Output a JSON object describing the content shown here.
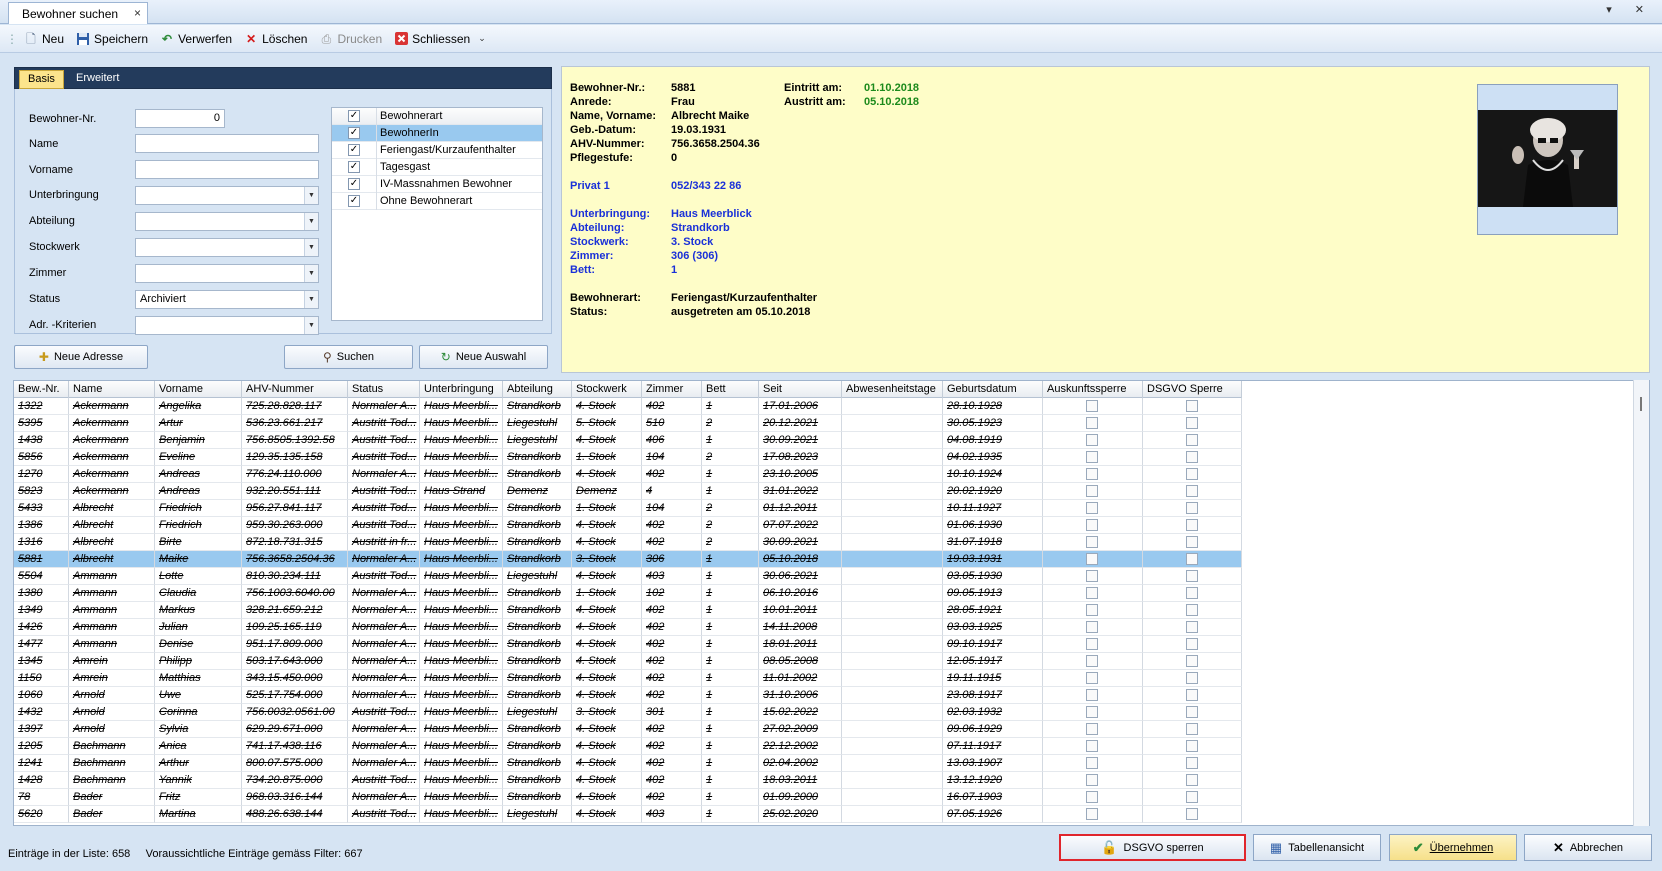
{
  "window": {
    "tab_title": "Bewohner suchen",
    "tab_close": "×",
    "controls": "▾ ✕"
  },
  "toolbar": {
    "grip": "⋮",
    "buttons": [
      {
        "label": "Neu",
        "icon": "new-doc-icon",
        "glyph": "🗋"
      },
      {
        "label": "Speichern",
        "icon": "save-icon",
        "glyph": "💾"
      },
      {
        "label": "Verwerfen",
        "icon": "discard-icon",
        "glyph": "↶"
      },
      {
        "label": "Löschen",
        "icon": "delete-icon",
        "glyph": "✕"
      },
      {
        "label": "Drucken",
        "icon": "print-icon",
        "glyph": "⎙"
      },
      {
        "label": "Schliessen",
        "icon": "close-icon",
        "glyph": "✖"
      }
    ],
    "more": "⌄"
  },
  "search": {
    "tabs": [
      "Basis",
      "Erweitert"
    ],
    "labels": {
      "bewohner_nr": "Bewohner-Nr.",
      "name": "Name",
      "vorname": "Vorname",
      "unterbringung": "Unterbringung",
      "abteilung": "Abteilung",
      "stockwerk": "Stockwerk",
      "zimmer": "Zimmer",
      "status": "Status",
      "adr_kriterien": "Adr. -Kriterien"
    },
    "values": {
      "bewohner_nr": "0",
      "name": "",
      "vorname": "",
      "unterbringung": "",
      "abteilung": "",
      "stockwerk": "",
      "zimmer": "",
      "status": "Archiviert",
      "adr_kriterien": ""
    },
    "types": [
      {
        "label": "Bewohnerart",
        "checked": true
      },
      {
        "label": "BewohnerIn",
        "checked": true
      },
      {
        "label": "Feriengast/Kurzaufenthalter",
        "checked": true
      },
      {
        "label": "Tagesgast",
        "checked": true
      },
      {
        "label": "IV-Massnahmen Bewohner",
        "checked": true
      },
      {
        "label": "Ohne Bewohnerart",
        "checked": true
      }
    ],
    "buttons": {
      "neue_adresse": "Neue Adresse",
      "suchen": "Suchen",
      "neue_auswahl": "Neue Auswahl"
    }
  },
  "detail": {
    "labels": {
      "bewohner_nr": "Bewohner-Nr.:",
      "anrede": "Anrede:",
      "name_vorname": "Name, Vorname:",
      "geb_datum": "Geb.-Datum:",
      "ahv": "AHV-Nummer:",
      "pflegestufe": "Pflegestufe:",
      "privat": "Privat 1",
      "unterbringung": "Unterbringung:",
      "abteilung": "Abteilung:",
      "stockwerk": "Stockwerk:",
      "zimmer": "Zimmer:",
      "bett": "Bett:",
      "bewohnerart": "Bewohnerart:",
      "status": "Status:",
      "eintritt": "Eintritt am:",
      "austritt": "Austritt am:"
    },
    "values": {
      "bewohner_nr": "5881",
      "anrede": "Frau",
      "name_vorname": "Albrecht Maike",
      "geb_datum": "19.03.1931",
      "ahv": "756.3658.2504.36",
      "pflegestufe": "0",
      "privat": "052/343 22 86",
      "unterbringung": "Haus Meerblick",
      "abteilung": "Strandkorb",
      "stockwerk": "3. Stock",
      "zimmer": "306 (306)",
      "bett": "1",
      "bewohnerart": "Feriengast/Kurzaufenthalter",
      "status": "ausgetreten am 05.10.2018",
      "eintritt": "01.10.2018",
      "austritt": "05.10.2018"
    }
  },
  "grid": {
    "columns": [
      "Bew.-Nr.",
      "Name",
      "Vorname",
      "AHV-Nummer",
      "Status",
      "Unterbringung",
      "Abteilung",
      "Stockwerk",
      "Zimmer",
      "Bett",
      "Seit",
      "Abwesenheitstage",
      "Geburtsdatum",
      "Auskunftssperre",
      "DSGVO Sperre"
    ],
    "selected_index": 9,
    "rows": [
      [
        "1322",
        "Ackermann",
        "Angelika",
        "725.28.828.117",
        "Normaler A...",
        "Haus Meerbli...",
        "Strandkorb",
        "4. Stock",
        "402",
        "1",
        "17.01.2006",
        "",
        "28.10.1928"
      ],
      [
        "5395",
        "Ackermann",
        "Artur",
        "536.23.661.217",
        "Austritt Tod...",
        "Haus Meerbli...",
        "Liegestuhl",
        "5. Stock",
        "510",
        "2",
        "20.12.2021",
        "",
        "30.05.1923"
      ],
      [
        "1438",
        "Ackermann",
        "Benjamin",
        "756.8505.1392.58",
        "Austritt Tod...",
        "Haus Meerbli...",
        "Liegestuhl",
        "4. Stock",
        "406",
        "1",
        "30.09.2021",
        "",
        "04.08.1919"
      ],
      [
        "5856",
        "Ackermann",
        "Eveline",
        "129.35.135.158",
        "Austritt Tod...",
        "Haus Meerbli...",
        "Strandkorb",
        "1. Stock",
        "104",
        "2",
        "17.08.2023",
        "",
        "04.02.1935"
      ],
      [
        "1270",
        "Ackermann",
        "Andreas",
        "776.24.110.000",
        "Normaler A...",
        "Haus Meerbli...",
        "Strandkorb",
        "4. Stock",
        "402",
        "1",
        "23.10.2005",
        "",
        "10.10.1924"
      ],
      [
        "5823",
        "Ackermann",
        "Andreas",
        "932.20.551.111",
        "Austritt Tod...",
        "Haus Strand",
        "Demenz",
        "Demenz",
        "4",
        "1",
        "31.01.2022",
        "",
        "20.02.1920"
      ],
      [
        "5433",
        "Albrecht",
        "Friedrich",
        "956.27.841.117",
        "Austritt Tod...",
        "Haus Meerbli...",
        "Strandkorb",
        "1. Stock",
        "104",
        "2",
        "01.12.2011",
        "",
        "10.11.1927"
      ],
      [
        "1386",
        "Albrecht",
        "Friedrich",
        "959.30.263.000",
        "Austritt Tod...",
        "Haus Meerbli...",
        "Strandkorb",
        "4. Stock",
        "402",
        "2",
        "07.07.2022",
        "",
        "01.06.1930"
      ],
      [
        "1316",
        "Albrecht",
        "Birte",
        "872.18.731.315",
        "Austritt in fr...",
        "Haus Meerbli...",
        "Strandkorb",
        "4. Stock",
        "402",
        "2",
        "30.09.2021",
        "",
        "31.07.1918"
      ],
      [
        "5881",
        "Albrecht",
        "Maike",
        "756.3658.2504.36",
        "Normaler A...",
        "Haus Meerbli...",
        "Strandkorb",
        "3. Stock",
        "306",
        "1",
        "05.10.2018",
        "",
        "19.03.1931"
      ],
      [
        "5504",
        "Ammann",
        "Lotte",
        "810.30.234.111",
        "Austritt Tod...",
        "Haus Meerbli...",
        "Liegestuhl",
        "4. Stock",
        "403",
        "1",
        "30.06.2021",
        "",
        "03.05.1930"
      ],
      [
        "1380",
        "Ammann",
        "Claudia",
        "756.1003.6040.00",
        "Normaler A...",
        "Haus Meerbli...",
        "Strandkorb",
        "1. Stock",
        "102",
        "1",
        "06.10.2016",
        "",
        "09.05.1913"
      ],
      [
        "1349",
        "Ammann",
        "Markus",
        "328.21.659.212",
        "Normaler A...",
        "Haus Meerbli...",
        "Strandkorb",
        "4. Stock",
        "402",
        "1",
        "10.01.2011",
        "",
        "28.05.1921"
      ],
      [
        "1426",
        "Ammann",
        "Julian",
        "109.25.165.119",
        "Normaler A...",
        "Haus Meerbli...",
        "Strandkorb",
        "4. Stock",
        "402",
        "1",
        "14.11.2008",
        "",
        "03.03.1925"
      ],
      [
        "1477",
        "Ammann",
        "Denise",
        "951.17.809.000",
        "Normaler A...",
        "Haus Meerbli...",
        "Strandkorb",
        "4. Stock",
        "402",
        "1",
        "18.01.2011",
        "",
        "09.10.1917"
      ],
      [
        "1345",
        "Amrein",
        "Philipp",
        "503.17.643.000",
        "Normaler A...",
        "Haus Meerbli...",
        "Strandkorb",
        "4. Stock",
        "402",
        "1",
        "08.05.2008",
        "",
        "12.05.1917"
      ],
      [
        "1150",
        "Amrein",
        "Matthias",
        "343.15.450.000",
        "Normaler A...",
        "Haus Meerbli...",
        "Strandkorb",
        "4. Stock",
        "402",
        "1",
        "11.01.2002",
        "",
        "19.11.1915"
      ],
      [
        "1060",
        "Arnold",
        "Uwe",
        "525.17.754.000",
        "Normaler A...",
        "Haus Meerbli...",
        "Strandkorb",
        "4. Stock",
        "402",
        "1",
        "31.10.2006",
        "",
        "23.08.1917"
      ],
      [
        "1432",
        "Arnold",
        "Corinna",
        "756.0032.0561.00",
        "Austritt Tod...",
        "Haus Meerbli...",
        "Liegestuhl",
        "3. Stock",
        "301",
        "1",
        "15.02.2022",
        "",
        "02.03.1932"
      ],
      [
        "1397",
        "Arnold",
        "Sylvia",
        "629.29.671.000",
        "Normaler A...",
        "Haus Meerbli...",
        "Strandkorb",
        "4. Stock",
        "402",
        "1",
        "27.02.2009",
        "",
        "09.06.1929"
      ],
      [
        "1205",
        "Bachmann",
        "Anica",
        "741.17.438.116",
        "Normaler A...",
        "Haus Meerbli...",
        "Strandkorb",
        "4. Stock",
        "402",
        "1",
        "22.12.2002",
        "",
        "07.11.1917"
      ],
      [
        "1241",
        "Bachmann",
        "Arthur",
        "800.07.575.000",
        "Normaler A...",
        "Haus Meerbli...",
        "Strandkorb",
        "4. Stock",
        "402",
        "1",
        "02.04.2002",
        "",
        "13.03.1907"
      ],
      [
        "1428",
        "Bachmann",
        "Yannik",
        "734.20.875.000",
        "Austritt Tod...",
        "Haus Meerbli...",
        "Strandkorb",
        "4. Stock",
        "402",
        "1",
        "18.03.2011",
        "",
        "13.12.1920"
      ],
      [
        "78",
        "Bader",
        "Fritz",
        "968.03.316.144",
        "Normaler A...",
        "Haus Meerbli...",
        "Strandkorb",
        "4. Stock",
        "402",
        "1",
        "01.09.2000",
        "",
        "16.07.1903"
      ],
      [
        "5620",
        "Bader",
        "Martina",
        "488.26.638.144",
        "Austritt Tod...",
        "Haus Meerbli...",
        "Liegestuhl",
        "4. Stock",
        "403",
        "1",
        "25.02.2020",
        "",
        "07.05.1926"
      ]
    ]
  },
  "status_bar": {
    "entries": "Einträge in der Liste: 658",
    "expected": "Voraussichtliche Einträge gemäss Filter: 667"
  },
  "bottom_buttons": {
    "dsgvo": "DSGVO sperren",
    "tabellenansicht": "Tabellenansicht",
    "uebernehmen": "Übernehmen",
    "abbrechen": "Abbrechen"
  },
  "colors": {
    "accent_yellow": "#fefdc8",
    "selection": "#99c9ef",
    "tab_dark": "#233b5c",
    "highlight_border": "#e0252c"
  }
}
